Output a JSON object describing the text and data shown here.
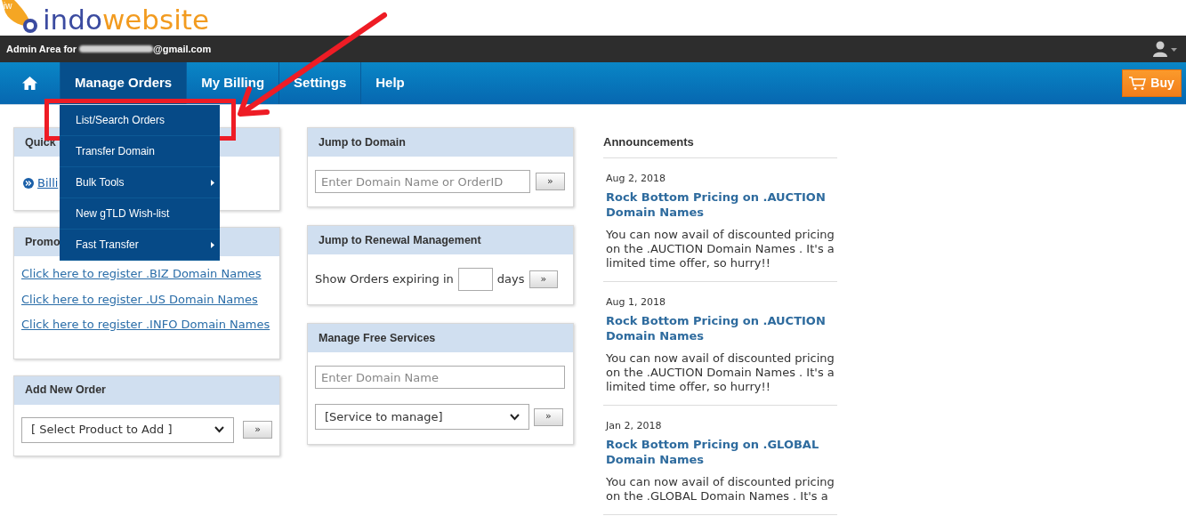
{
  "logo": {
    "badge": "iw",
    "first": "indo",
    "second": "website"
  },
  "admin_bar": {
    "label": "Admin Area for",
    "email_domain": "@gmail.com"
  },
  "nav": {
    "items": [
      {
        "kind": "home",
        "selected": false
      },
      {
        "kind": "text",
        "label": "Manage Orders",
        "selected": true
      },
      {
        "kind": "text",
        "label": "My Billing",
        "selected": false
      },
      {
        "kind": "text",
        "label": "Settings",
        "selected": false
      },
      {
        "kind": "text",
        "label": "Help",
        "selected": false
      }
    ],
    "buy": "Buy"
  },
  "dropdown": [
    {
      "label": "List/Search Orders",
      "submenu": false
    },
    {
      "label": "Transfer Domain",
      "submenu": false
    },
    {
      "label": "Bulk Tools",
      "submenu": true
    },
    {
      "label": "New gTLD Wish-list",
      "submenu": false
    },
    {
      "label": "Fast Transfer",
      "submenu": true
    }
  ],
  "quick_panel": {
    "title": "Quick",
    "link": "Billi"
  },
  "promo_panel": {
    "title": "Promo",
    "links": [
      "Click here to register .BIZ Domain Names",
      "Click here to register .US Domain Names",
      "Click here to register .INFO Domain Names"
    ]
  },
  "add_order": {
    "title": "Add New Order",
    "select": "[ Select Product to Add ]",
    "go": "»"
  },
  "jump_domain": {
    "title": "Jump to Domain",
    "placeholder": "Enter Domain Name or OrderID",
    "go": "»"
  },
  "renewal": {
    "title": "Jump to Renewal Management",
    "before": "Show Orders expiring in",
    "after": "days",
    "go": "»"
  },
  "free_services": {
    "title": "Manage Free Services",
    "placeholder": "Enter Domain Name",
    "select": "[Service to manage]",
    "go": "»"
  },
  "announcements": {
    "title": "Announcements",
    "items": [
      {
        "date": "Aug 2, 2018",
        "title": "Rock Bottom Pricing on .AUCTION Domain Names",
        "body": "You can now avail of discounted pricing on the .AUCTION Domain Names . It's a limited time offer, so hurry!!"
      },
      {
        "date": "Aug 1, 2018",
        "title": "Rock Bottom Pricing on .AUCTION Domain Names",
        "body": "You can now avail of discounted pricing on the .AUCTION Domain Names . It's a limited time offer, so hurry!!"
      },
      {
        "date": "Jan 2, 2018",
        "title": "Rock Bottom Pricing on .GLOBAL Domain Names",
        "body": "You can now avail of discounted pricing on the .GLOBAL Domain Names . It's a"
      }
    ]
  }
}
